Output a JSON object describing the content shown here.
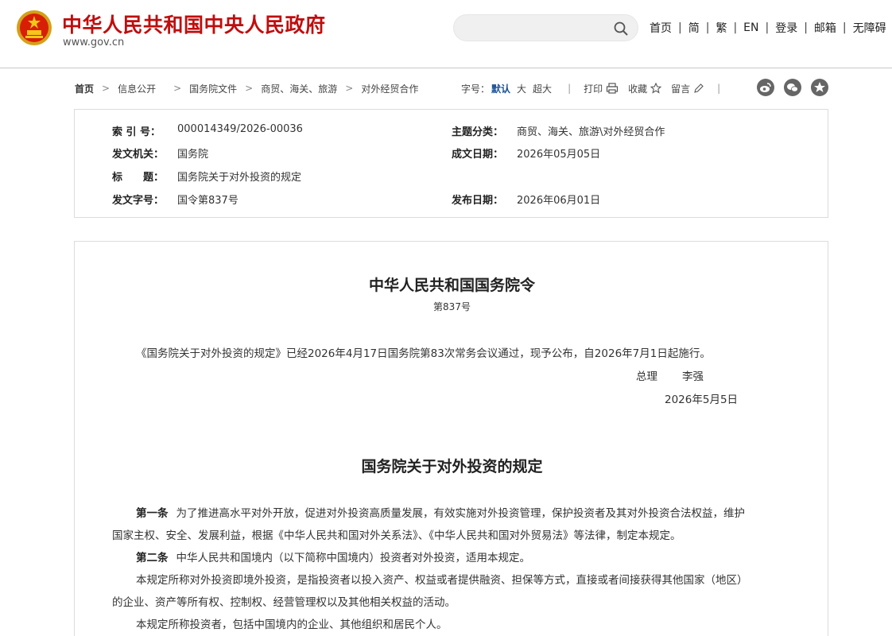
{
  "header": {
    "site_title": "中华人民共和国中央人民政府",
    "site_url": "www.gov.cn",
    "search": {
      "value": "",
      "placeholder": ""
    },
    "links": [
      "首页",
      "简",
      "繁",
      "EN",
      "登录",
      "邮箱",
      "无障碍"
    ]
  },
  "breadcrumb": [
    "首页",
    "信息公开",
    "国务院文件",
    "商贸、海关、旅游",
    "对外经贸合作"
  ],
  "toolbar": {
    "font_size_label": "字号：",
    "font_sizes": [
      "默认",
      "大",
      "超大"
    ],
    "print_label": "打印",
    "favorite_label": "收藏",
    "comment_label": "留言"
  },
  "metadata": {
    "index_label": "索 引 号：",
    "index_value": "000014349/2026-00036",
    "topic_label": "主题分类：",
    "topic_value": "商贸、海关、旅游\\对外经贸合作",
    "issuer_label": "发文机关：",
    "issuer_value": "国务院",
    "written_date_label": "成文日期：",
    "written_date_value": "2026年05月05日",
    "title_label": "标　　题：",
    "title_value": "国务院关于对外投资的规定",
    "doc_no_label": "发文字号：",
    "doc_no_value": "国令第837号",
    "publish_date_label": "发布日期：",
    "publish_date_value": "2026年06月01日"
  },
  "document": {
    "order_title": "中华人民共和国国务院令",
    "order_number": "第837号",
    "intro": "《国务院关于对外投资的规定》已经2026年4月17日国务院第83次常务会议通过，现予公布，自2026年7月1日起施行。",
    "signer_title": "总理",
    "signer_name": "李强",
    "sign_date": "2026年5月5日",
    "regulation_title": "国务院关于对外投资的规定",
    "article1_label": "第一条",
    "article1_line1": "为了推进高水平对外开放，促进对外投资高质量发展，有效实施对外投资管理，保护投资者及其对外投资合法权益，维护",
    "article1_line2": "国家主权、安全、发展利益，根据《中华人民共和国对外关系法》、《中华人民共和国对外贸易法》等法律，制定本规定。",
    "article2_label": "第二条",
    "article2_line1": "中华人民共和国境内（以下简称中国境内）投资者对外投资，适用本规定。",
    "para3_line1": "本规定所称对外投资即境外投资，是指投资者以投入资产、权益或者提供融资、担保等方式，直接或者间接获得其他国家（地区）",
    "para3_line2": "的企业、资产等所有权、控制权、经营管理权以及其他相关权益的活动。",
    "para4_line1": "本规定所称投资者，包括中国境内的企业、其他组织和居民个人。"
  },
  "colors": {
    "brand_red": "#c00d0d",
    "active_font_size": "#1a4f94"
  },
  "icons": [
    "national-emblem-icon",
    "search-icon",
    "printer-icon",
    "star-icon",
    "pencil-icon",
    "weibo-icon",
    "wechat-icon",
    "qzone-icon"
  ]
}
